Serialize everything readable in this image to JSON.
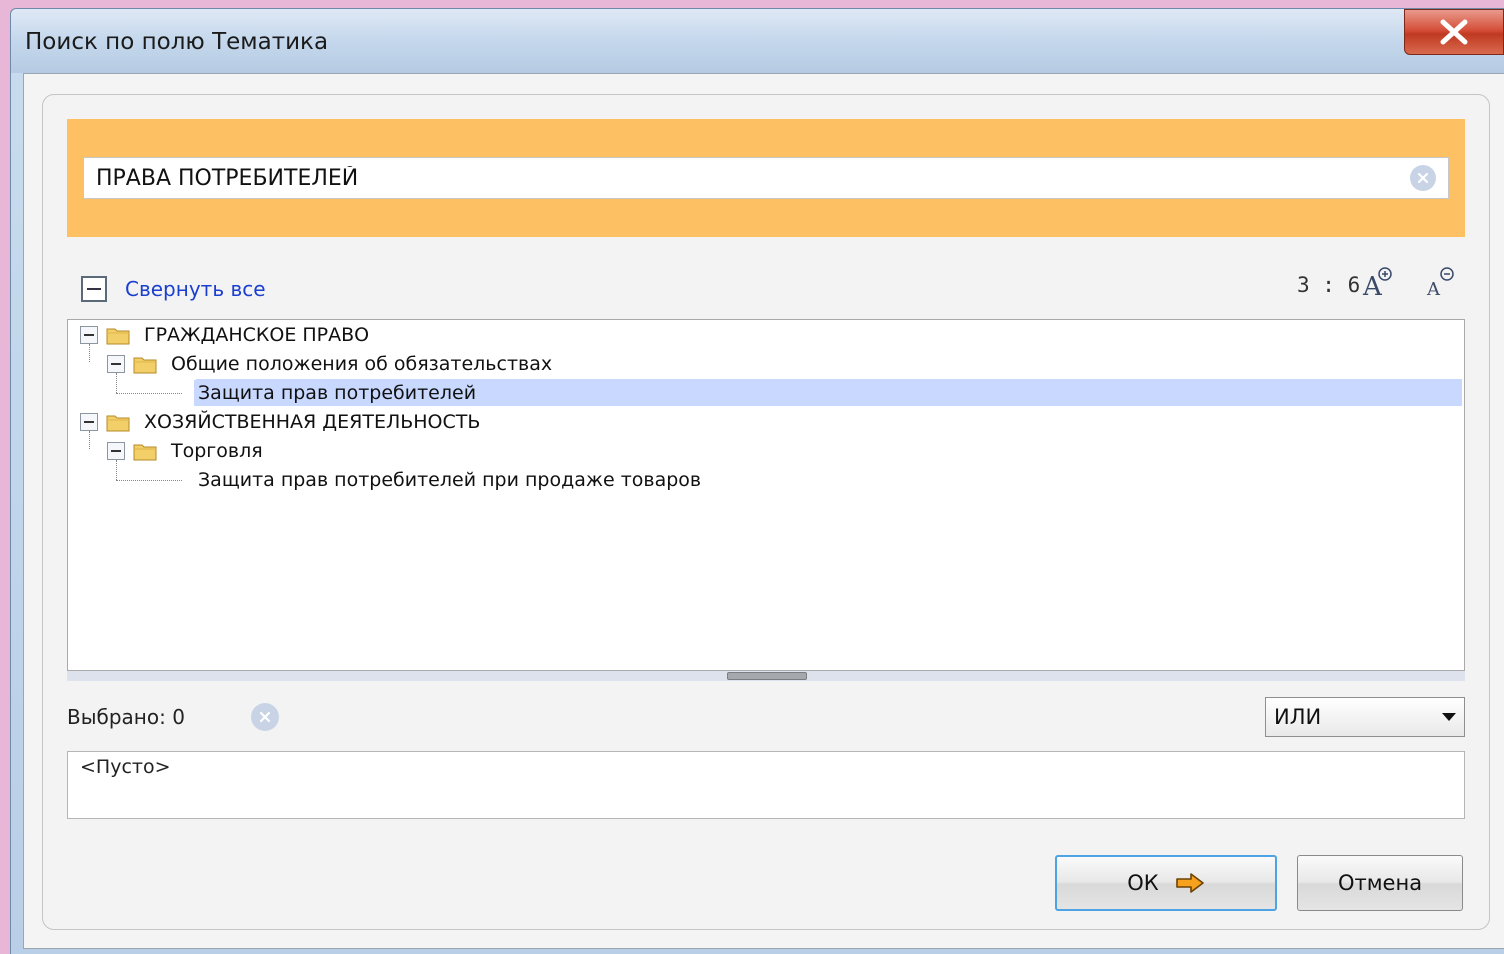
{
  "window": {
    "title": "Поиск по полю Тематика"
  },
  "search": {
    "value": "ПРАВА ПОТРЕБИТЕЛЕЙ"
  },
  "toolbar": {
    "collapse_all": "Свернуть все",
    "counter": "3 : 6"
  },
  "tree": {
    "items": [
      {
        "label": "ГРАЖДАНСКОЕ ПРАВО",
        "level": 0,
        "type": "folder",
        "expanded": true,
        "selected": false
      },
      {
        "label": "Общие положения об обязательствах",
        "level": 1,
        "type": "folder",
        "expanded": true,
        "selected": false
      },
      {
        "label": "Защита прав потребителей",
        "level": 2,
        "type": "leaf",
        "selected": true
      },
      {
        "label": "ХОЗЯЙСТВЕННАЯ ДЕЯТЕЛЬНОСТЬ",
        "level": 0,
        "type": "folder",
        "expanded": true,
        "selected": false
      },
      {
        "label": "Торговля",
        "level": 1,
        "type": "folder",
        "expanded": true,
        "selected": false
      },
      {
        "label": "Защита прав потребителей при продаже товаров",
        "level": 2,
        "type": "leaf",
        "selected": false
      }
    ]
  },
  "selection": {
    "label": "Выбрано: 0",
    "operator": "ИЛИ",
    "empty_text": "<Пусто>"
  },
  "buttons": {
    "ok": "ОК",
    "cancel": "Отмена"
  },
  "colors": {
    "accent_orange": "#fdc164",
    "selection_blue": "#c8d8ff",
    "link_blue": "#1b3fcf"
  }
}
